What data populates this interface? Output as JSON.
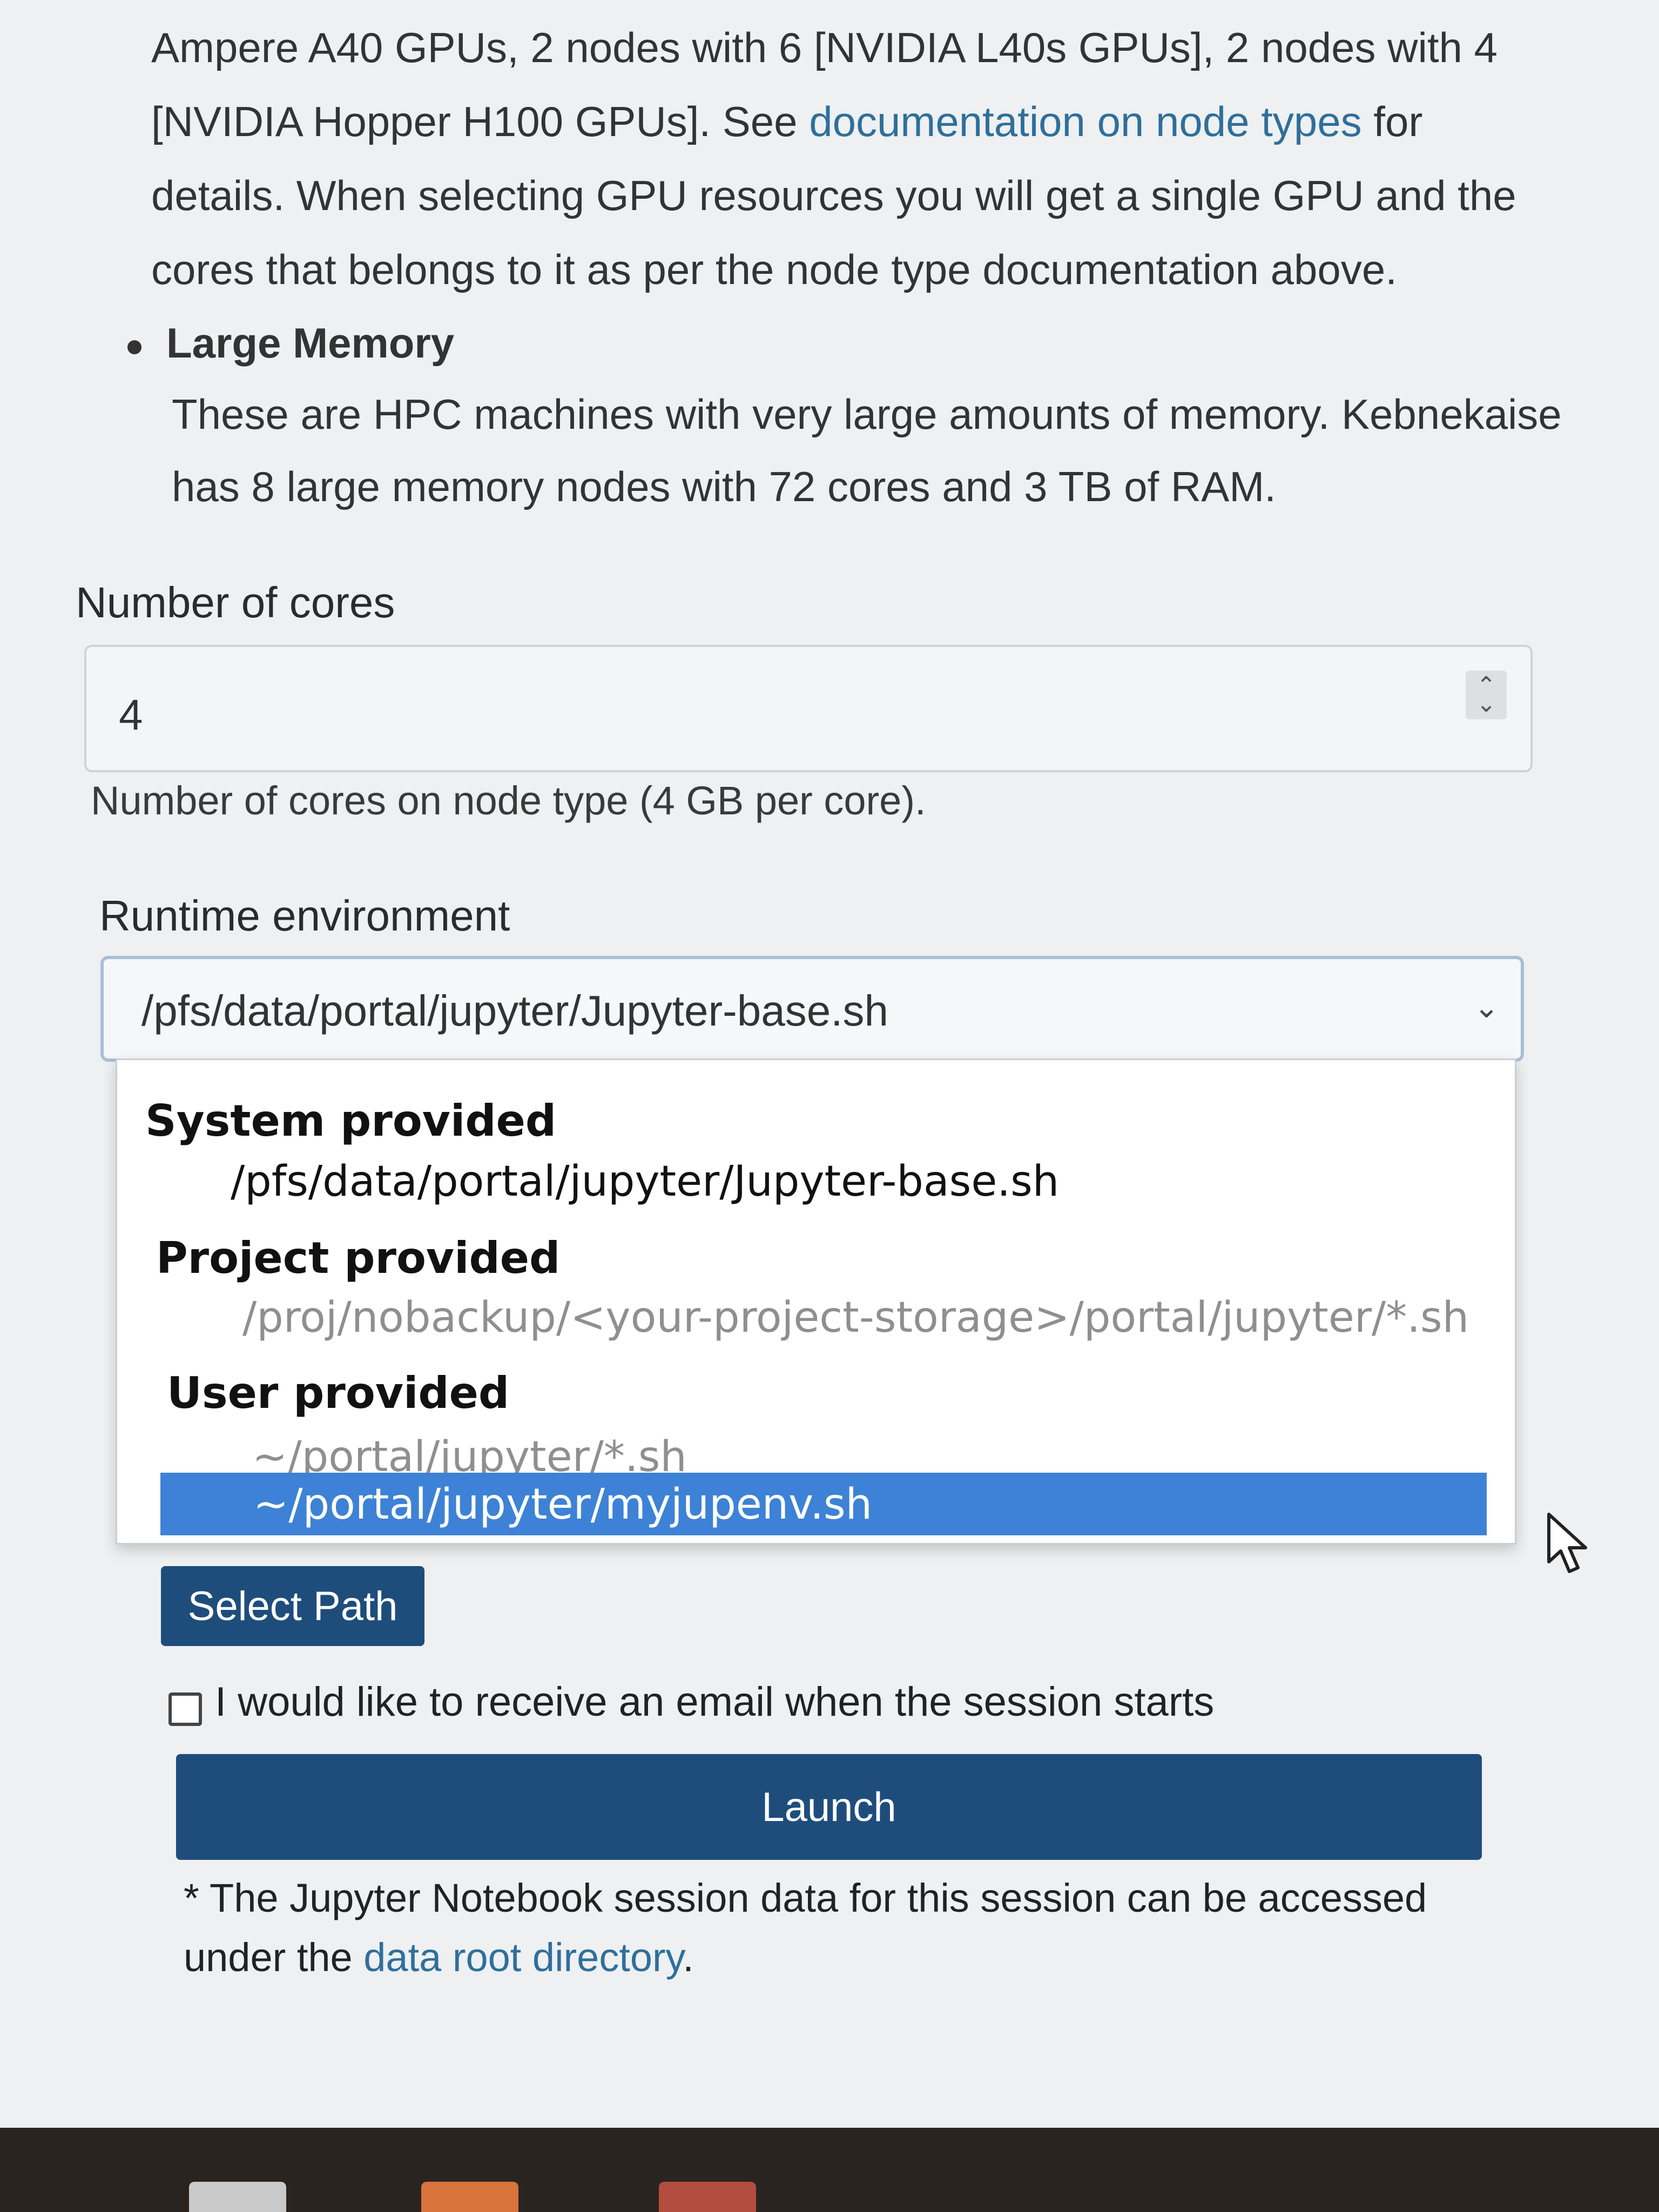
{
  "description": {
    "paragraph_parts": [
      "Ampere A40 GPUs, 2 nodes with 6 [NVIDIA L40s GPUs], 2 nodes with 4 [NVIDIA Hopper H100 GPUs]. See ",
      "documentation on node types",
      " for details. When selecting GPU resources you will get a single GPU and the cores that belongs to it as per the node type documentation above."
    ],
    "bullet_title": "Large Memory",
    "bullet_body": "These are HPC machines with very large amounts of memory. Kebnekaise has 8 large memory nodes with 72 cores and 3 TB of RAM."
  },
  "cores": {
    "label": "Number of cores",
    "value": "4",
    "help": "Number of cores on node type (4 GB per core)."
  },
  "runtime": {
    "label": "Runtime environment",
    "selected_value": "/pfs/data/portal/jupyter/Jupyter-base.sh",
    "groups": [
      {
        "label": "System provided",
        "options": [
          {
            "text": "/pfs/data/portal/jupyter/Jupyter-base.sh",
            "disabled": false
          }
        ]
      },
      {
        "label": "Project provided",
        "options": [
          {
            "text": "/proj/nobackup/<your-project-storage>/portal/jupyter/*.sh",
            "disabled": true
          }
        ]
      },
      {
        "label": "User provided",
        "options": [
          {
            "text": "~/portal/jupyter/*.sh",
            "disabled": true
          },
          {
            "text": "~/portal/jupyter/myjupenv.sh",
            "disabled": false,
            "highlighted": true
          }
        ]
      }
    ]
  },
  "select_path_label": "Select Path",
  "email_checkbox": {
    "label": "I would like to receive an email when the session starts",
    "checked": false
  },
  "launch_label": "Launch",
  "note": {
    "prefix": "* The Jupyter Notebook session data for this session can be accessed under the ",
    "link": "data root directory",
    "suffix": "."
  },
  "colors": {
    "primary_button": "#1e4d7c",
    "highlight": "#3d82d6",
    "link": "#2f6f9a"
  }
}
